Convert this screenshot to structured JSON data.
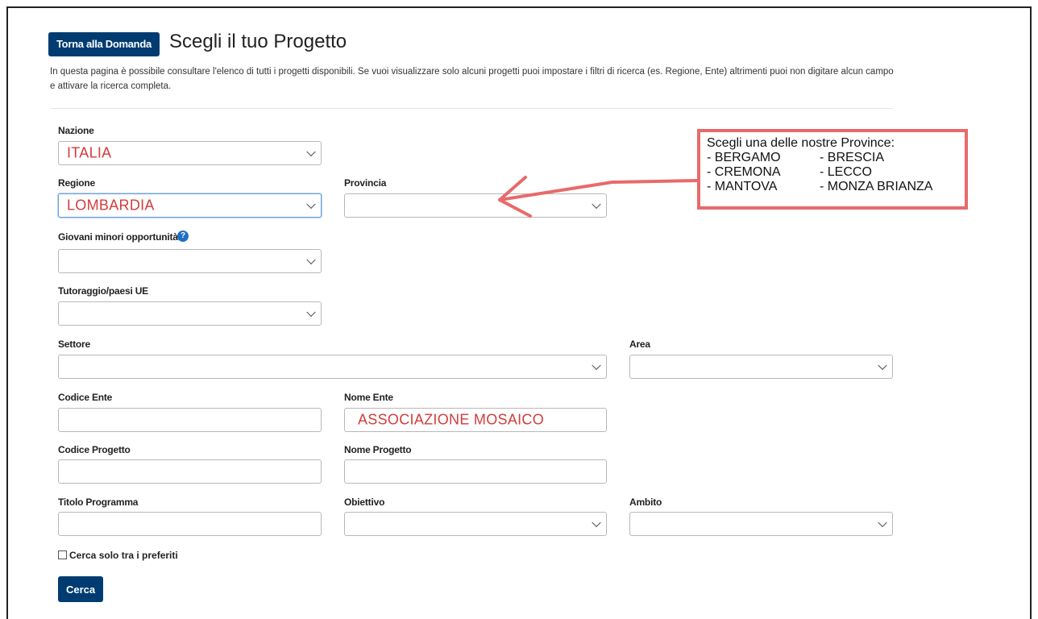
{
  "header": {
    "back_label": "Torna alla Domanda",
    "title": "Scegli il tuo Progetto",
    "intro": "In questa pagina è possibile consultare l'elenco di tutti i progetti disponibili. Se vuoi visualizzare solo alcuni progetti puoi impostare i filtri di ricerca (es. Regione, Ente) altrimenti puoi non digitare alcun campo e attivare la ricerca completa."
  },
  "form": {
    "nazione": {
      "label": "Nazione",
      "value": "ITALIA"
    },
    "regione": {
      "label": "Regione",
      "value": "LOMBARDIA"
    },
    "provincia": {
      "label": "Provincia",
      "value": ""
    },
    "giovani": {
      "label": "Giovani minori opportunità",
      "value": ""
    },
    "tutoraggio": {
      "label": "Tutoraggio/paesi UE",
      "value": ""
    },
    "settore": {
      "label": "Settore",
      "value": ""
    },
    "area": {
      "label": "Area",
      "value": ""
    },
    "codice_ente": {
      "label": "Codice Ente",
      "value": ""
    },
    "nome_ente": {
      "label": "Nome Ente",
      "value": "ASSOCIAZIONE MOSAICO"
    },
    "codice_progetto": {
      "label": "Codice Progetto",
      "value": ""
    },
    "nome_progetto": {
      "label": "Nome Progetto",
      "value": ""
    },
    "titolo_programma": {
      "label": "Titolo Programma",
      "value": ""
    },
    "obiettivo": {
      "label": "Obiettivo",
      "value": ""
    },
    "ambito": {
      "label": "Ambito",
      "value": ""
    },
    "preferiti_label": "Cerca solo tra i preferiti",
    "search_label": "Cerca",
    "help_glyph": "?"
  },
  "annotation": {
    "title": "Scegli una delle nostre Province:",
    "rows": [
      [
        "- BERGAMO",
        "- BRESCIA"
      ],
      [
        "- CREMONA",
        "- LECCO"
      ],
      [
        "- MANTOVA",
        "- MONZA BRIANZA"
      ]
    ],
    "color": "#e86a6a"
  },
  "colors": {
    "primary": "#003c71",
    "input_value": "#d23c3c",
    "help_icon": "#1f6fc4"
  }
}
